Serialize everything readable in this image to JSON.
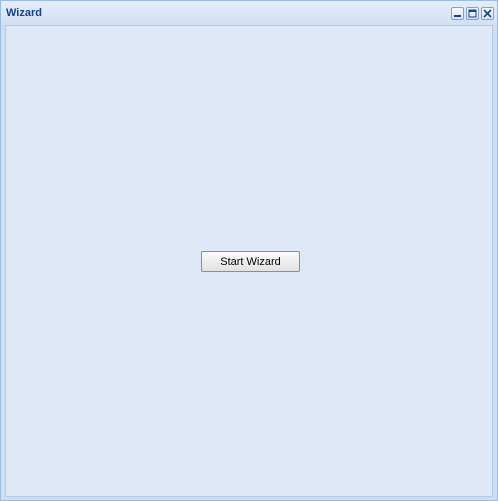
{
  "window": {
    "title": "Wizard"
  },
  "tools": {
    "minimize_icon": "minimize-icon",
    "maximize_icon": "maximize-icon",
    "close_icon": "close-icon"
  },
  "main": {
    "start_button_label": "Start Wizard"
  },
  "colors": {
    "title_text": "#15428b",
    "panel_body": "#dfe8f6",
    "window_border": "#99bbe8"
  }
}
